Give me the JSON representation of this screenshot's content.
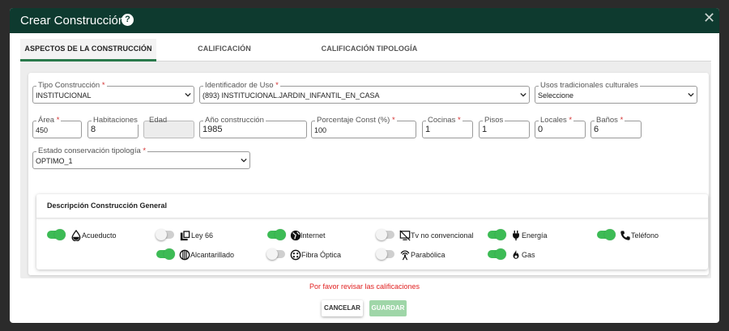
{
  "modal": {
    "title": "Crear Construcción",
    "help_glyph": "?",
    "close_glyph": "✕"
  },
  "tabs": [
    {
      "label": "ASPECTOS DE LA CONSTRUCCIÓN",
      "active": true
    },
    {
      "label": "CALIFICACIÓN",
      "active": false
    },
    {
      "label": "CALIFICACIÓN TIPOLOGÍA",
      "active": false
    }
  ],
  "form": {
    "tipo_construccion": {
      "label": "Tipo Construcción",
      "required": "*",
      "value": "INSTITUCIONAL"
    },
    "identificador_uso": {
      "label": "Identificador de Uso",
      "required": "*",
      "value": "(893) INSTITUCIONAL.JARDIN_INFANTIL_EN_CASA"
    },
    "usos_tradicionales": {
      "label": "Usos tradicionales culturales",
      "value": "Seleccione"
    },
    "area": {
      "label": "Área",
      "required": "*",
      "value": "450"
    },
    "habitaciones": {
      "label": "Habitaciones",
      "value": "8"
    },
    "edad": {
      "label": "Edad",
      "value": ""
    },
    "anio_construccion": {
      "label": "Año construcción",
      "value": "1985"
    },
    "porcentaje_const": {
      "label": "Porcentaje Const (%)",
      "required": "*",
      "value": "100"
    },
    "cocinas": {
      "label": "Cocinas",
      "required": "*",
      "value": "1"
    },
    "pisos": {
      "label": "Pisos",
      "value": "1"
    },
    "locales": {
      "label": "Locales",
      "required": "*",
      "value": "0"
    },
    "banos": {
      "label": "Baños",
      "required": "*",
      "value": "6"
    },
    "estado_conservacion": {
      "label": "Estado conservación tipología",
      "required": "*",
      "value": "OPTIMO_1"
    }
  },
  "descripcion": {
    "title": "Descripción Construcción General",
    "services": [
      {
        "label": "Acueducto",
        "on": true,
        "icon": "water-drop-icon"
      },
      {
        "label": "Ley 66",
        "on": false,
        "icon": "copy-pages-icon"
      },
      {
        "label": "Internet",
        "on": true,
        "icon": "globe-icon"
      },
      {
        "label": "Tv no convencional",
        "on": false,
        "icon": "tv-off-icon"
      },
      {
        "label": "Energía",
        "on": true,
        "icon": "plug-icon"
      },
      {
        "label": "Teléfono",
        "on": true,
        "icon": "phone-icon"
      },
      {
        "label": "Alcantarillado",
        "on": true,
        "icon": "sewer-circle-icon"
      },
      {
        "label": "Fibra Óptica",
        "on": false,
        "icon": "fiber-optic-icon"
      },
      {
        "label": "Parabólica",
        "on": false,
        "icon": "satellite-dish-icon"
      },
      {
        "label": "Gas",
        "on": true,
        "icon": "flame-icon"
      }
    ]
  },
  "footer": {
    "warning": "Por favor revisar las calificaciones",
    "cancel_label": "CANCELAR",
    "save_label": "GUARDAR"
  },
  "colors": {
    "header_bg": "#0e3a2f",
    "toggle_on": "#3dbb55",
    "tab_active_border": "#2a7a4c",
    "warning": "#e02020",
    "save_disabled": "#9fd6a8"
  }
}
